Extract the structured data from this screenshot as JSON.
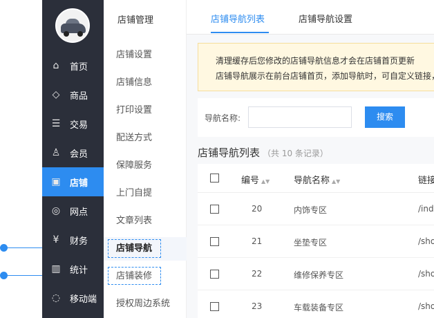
{
  "sidebar": {
    "items": [
      {
        "label": "首页",
        "icon": "home-icon",
        "glyph": "⌂"
      },
      {
        "label": "商品",
        "icon": "tag-icon",
        "glyph": "◇"
      },
      {
        "label": "交易",
        "icon": "list-icon",
        "glyph": "☰"
      },
      {
        "label": "会员",
        "icon": "user-icon",
        "glyph": "♙"
      },
      {
        "label": "店铺",
        "icon": "store-icon",
        "glyph": "▣"
      },
      {
        "label": "网点",
        "icon": "location-icon",
        "glyph": "◎"
      },
      {
        "label": "财务",
        "icon": "yuan-icon",
        "glyph": "¥"
      },
      {
        "label": "统计",
        "icon": "bar-chart-icon",
        "glyph": "▥"
      },
      {
        "label": "移动端",
        "icon": "chat-icon",
        "glyph": "◌"
      }
    ],
    "active_index": 4
  },
  "submenu": {
    "title": "店铺管理",
    "items": [
      "店铺设置",
      "店铺信息",
      "打印设置",
      "配送方式",
      "保障服务",
      "上门自提",
      "文章列表",
      "店铺导航",
      "店铺装修",
      "授权周边系统"
    ],
    "active_index": 7
  },
  "tabs": [
    "店铺导航列表",
    "店铺导航设置"
  ],
  "notice": {
    "line1": "清理缓存后您修改的店铺导航信息才会在店铺首页更新",
    "line2": "店铺导航展示在前台店铺首页，添加导航时，可自定义链接，"
  },
  "search": {
    "label": "导航名称:",
    "value": "",
    "button": "搜索"
  },
  "list": {
    "title": "店铺导航列表",
    "count": "（共 10 条记录）",
    "headers": [
      "编号",
      "导航名称",
      "链接"
    ],
    "rows": [
      {
        "id": "20",
        "name": "内饰专区",
        "link": "/ind"
      },
      {
        "id": "21",
        "name": "坐垫专区",
        "link": "/sho"
      },
      {
        "id": "22",
        "name": "维修保养专区",
        "link": "/sho"
      },
      {
        "id": "23",
        "name": "车载装备专区",
        "link": "/sho"
      }
    ]
  },
  "colors": {
    "accent": "#2d8cf0",
    "sidebar_bg": "#2b2f3a",
    "notice_bg": "#fff8e1"
  }
}
